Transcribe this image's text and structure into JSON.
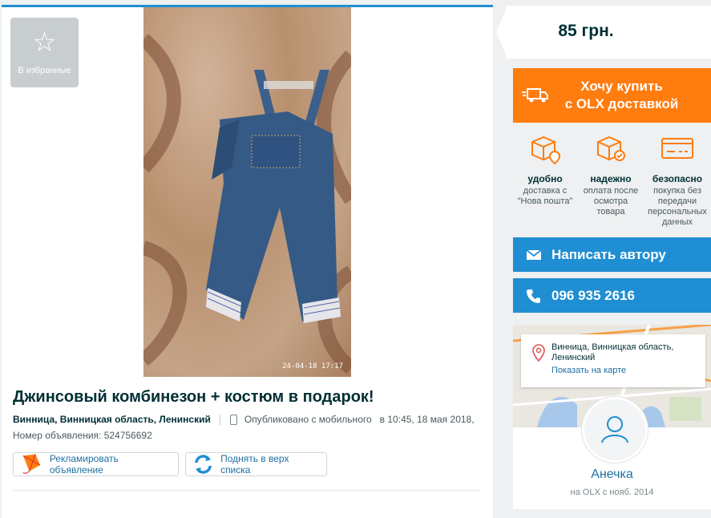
{
  "favorites": {
    "label": "В избранные",
    "icon": "star-icon"
  },
  "photo": {
    "timestamp": "24-04-18 17:17"
  },
  "ad": {
    "title": "Джинсовый комбинезон + костюм в подарок!",
    "location": "Винница, Винницкая область, Ленинский",
    "published_mobile": "Опубликовано с мобильного",
    "published_time": "в 10:45, 18 мая 2018,",
    "ad_number": "Номер объявления: 524756692"
  },
  "actions": {
    "promote": "Рекламировать объявление",
    "bump": "Поднять в верх списка"
  },
  "price": "85 грн.",
  "delivery_button": {
    "line1": "Хочу купить",
    "line2": "с OLX доставкой"
  },
  "features": [
    {
      "title": "удобно",
      "desc": "доставка с \"Нова пошта\"",
      "icon": "delivery-box-pin-icon"
    },
    {
      "title": "надежно",
      "desc": "оплата после осмотра товара",
      "icon": "box-check-icon"
    },
    {
      "title": "безопасно",
      "desc": "покупка без передачи персональных данных",
      "icon": "card-icon"
    }
  ],
  "message_button": "Написать автору",
  "phone_button": "096 935 2616",
  "map": {
    "address": "Винница, Винницкая область, Ленинский",
    "show_link": "Показать на карте"
  },
  "user": {
    "name": "Анечка",
    "since": "на OLX с нояб. 2014"
  },
  "colors": {
    "accent_blue": "#1f8ed3",
    "accent_orange": "#ff7c0f"
  }
}
